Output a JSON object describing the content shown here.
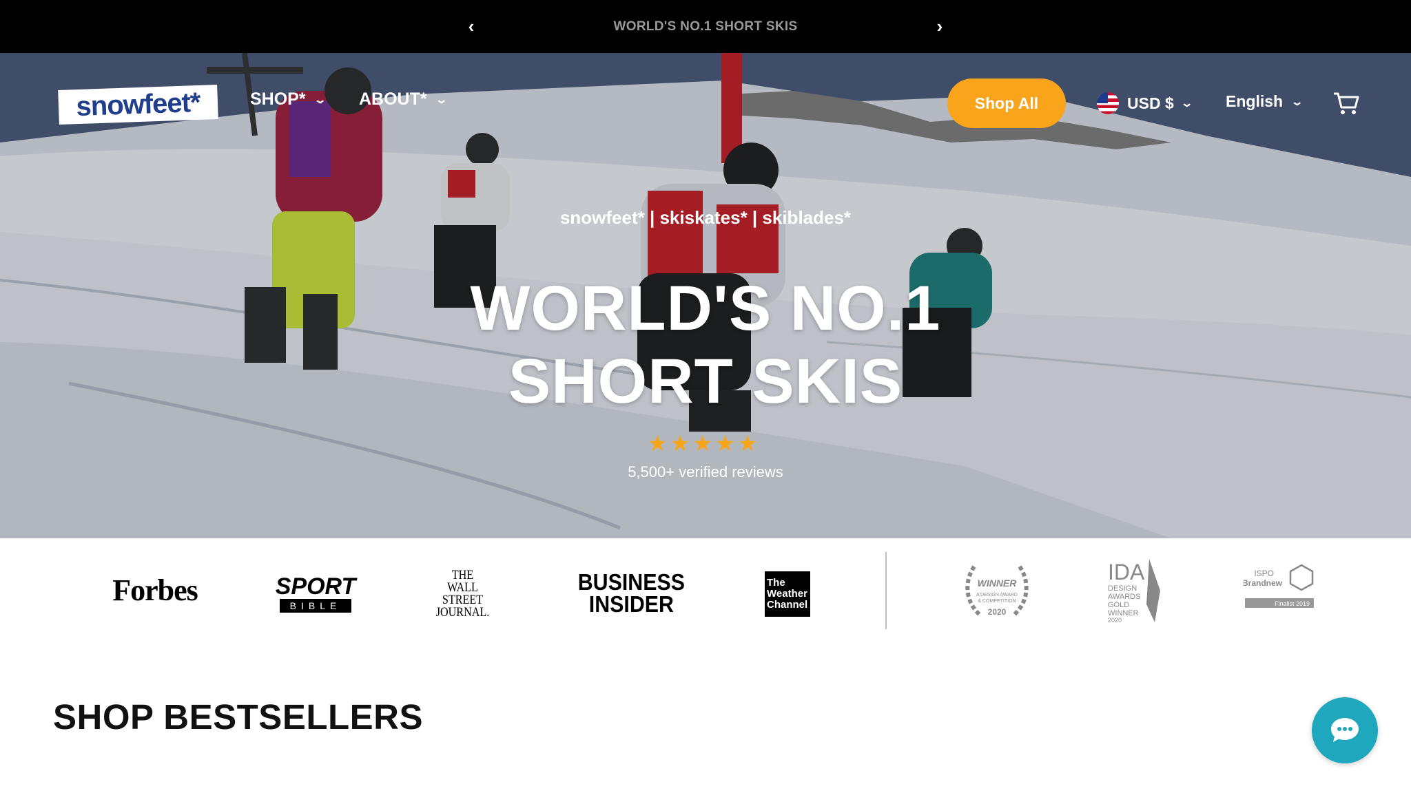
{
  "announcement": {
    "text": "WORLD'S NO.1 SHORT SKIS",
    "prev_icon": "chevron-left-icon",
    "next_icon": "chevron-right-icon"
  },
  "header": {
    "logo_text": "snowfeet*",
    "nav": [
      {
        "label": "SHOP*",
        "icon": "chevron-down-icon"
      },
      {
        "label": "ABOUT*",
        "icon": "chevron-down-icon"
      }
    ],
    "shop_all_label": "Shop All",
    "currency_label": "USD $",
    "currency_flag": "us-flag-icon",
    "language_label": "English",
    "cart_icon": "cart-icon"
  },
  "hero": {
    "tagline": "snowfeet* | skiskates* | skiblades*",
    "headline_line1": "WORLD'S NO.1",
    "headline_line2": "SHORT SKIS",
    "rating": 5,
    "reviews_text": "5,500+ verified reviews"
  },
  "press": {
    "logos": [
      "Forbes",
      "SPORT BIBLE",
      "THE WALL STREET JOURNAL.",
      "BUSINESS INSIDER",
      "The Weather Channel"
    ],
    "awards": [
      "WINNER A'DESIGN AWARD & COMPETITION 2020",
      "IDA DESIGN AWARDS GOLD WINNER 2020",
      "ISPO Brandnew Finalist 2019"
    ]
  },
  "bestsellers": {
    "title": "SHOP BESTSELLERS"
  },
  "chat": {
    "icon": "chat-bubble-icon"
  },
  "colors": {
    "accent": "#f9a41b",
    "brand_blue": "#1f3e8c",
    "chat": "#1ea7bd"
  }
}
